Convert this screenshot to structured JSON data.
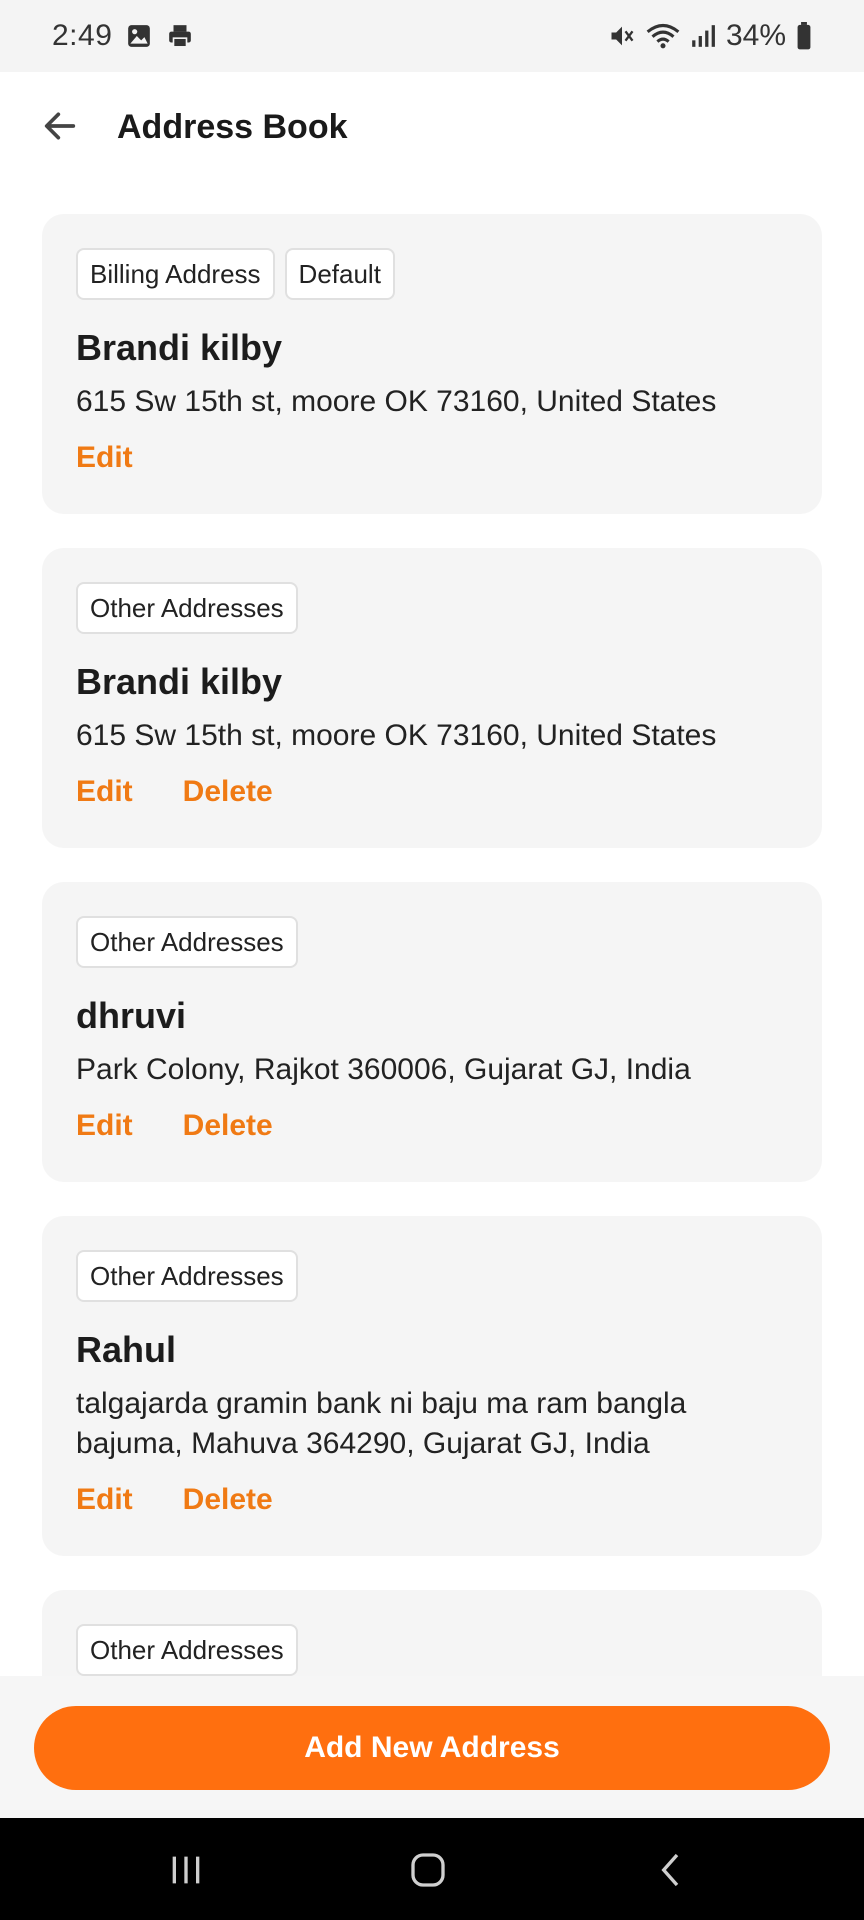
{
  "status_bar": {
    "time": "2:49",
    "battery": "34%",
    "icons": [
      "gallery-icon",
      "printer-icon",
      "mute-icon",
      "wifi-icon",
      "signal-icon",
      "battery-icon"
    ]
  },
  "header": {
    "title": "Address Book",
    "back_icon": "back-arrow-icon"
  },
  "addresses": [
    {
      "tags": [
        "Billing Address",
        "Default"
      ],
      "name": "Brandi kilby",
      "address": "615 Sw 15th st, moore OK 73160, United States",
      "edit_label": "Edit"
    },
    {
      "tags": [
        "Other Addresses"
      ],
      "name": "Brandi kilby",
      "address": "615 Sw 15th st, moore OK 73160, United States",
      "edit_label": "Edit",
      "delete_label": "Delete"
    },
    {
      "tags": [
        "Other Addresses"
      ],
      "name": "dhruvi",
      "address": "Park Colony, Rajkot 360006, Gujarat GJ, India",
      "edit_label": "Edit",
      "delete_label": "Delete"
    },
    {
      "tags": [
        "Other Addresses"
      ],
      "name": "Rahul",
      "address": "talgajarda gramin bank ni baju ma ram bangla bajuma, Mahuva 364290, Gujarat GJ, India",
      "edit_label": "Edit",
      "delete_label": "Delete"
    },
    {
      "tags": [
        "Other Addresses"
      ]
    }
  ],
  "add_button": {
    "label": "Add New Address"
  },
  "colors": {
    "accent": "#f07a14",
    "button": "#ff6f0f",
    "card_bg": "#f5f5f5"
  },
  "nav_bar": {
    "icons": [
      "recent-apps-icon",
      "home-icon",
      "back-icon"
    ]
  }
}
